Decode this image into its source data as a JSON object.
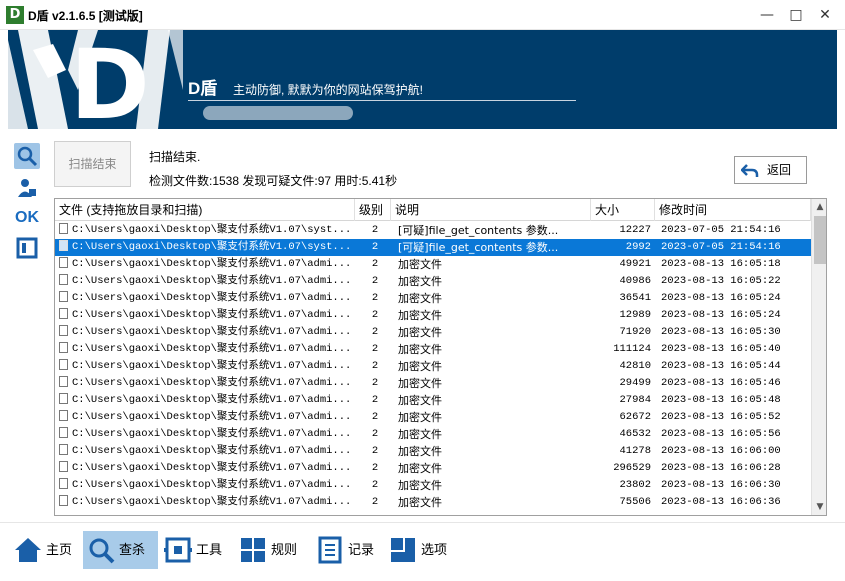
{
  "window": {
    "title": "D盾 v2.1.6.5 [测试版]",
    "minimize": "—",
    "maximize": "□",
    "close": "✕"
  },
  "banner": {
    "title": "D盾",
    "subtitle": "主动防御, 默默为你的网站保驾护航!",
    "logo_letter": "D"
  },
  "left_toolbar": {
    "items": [
      {
        "name": "search-icon",
        "active": true
      },
      {
        "name": "user-icon"
      },
      {
        "name": "ok-icon",
        "label": "OK"
      },
      {
        "name": "frame-icon"
      }
    ]
  },
  "scan": {
    "button_label": "扫描结束",
    "status": "扫描结束.",
    "stats": "检测文件数:1538 发现可疑文件:97 用时:5.41秒",
    "back_label": "返回"
  },
  "table": {
    "columns": [
      "文件 (支持拖放目录和扫描)",
      "级别",
      "说明",
      "大小",
      "修改时间"
    ],
    "rows": [
      {
        "file": "C:\\Users\\gaoxi\\Desktop\\聚支付系统V1.07\\syst...",
        "level": "2",
        "desc": "[可疑]file_get_contents 参数...",
        "size": "12227",
        "time": "2023-07-05 21:54:16",
        "selected": false
      },
      {
        "file": "C:\\Users\\gaoxi\\Desktop\\聚支付系统V1.07\\syst...",
        "level": "2",
        "desc": "[可疑]file_get_contents 参数...",
        "size": "2992",
        "time": "2023-07-05 21:54:16",
        "selected": true
      },
      {
        "file": "C:\\Users\\gaoxi\\Desktop\\聚支付系统V1.07\\admi...",
        "level": "2",
        "desc": "加密文件",
        "size": "49921",
        "time": "2023-08-13 16:05:18",
        "selected": false
      },
      {
        "file": "C:\\Users\\gaoxi\\Desktop\\聚支付系统V1.07\\admi...",
        "level": "2",
        "desc": "加密文件",
        "size": "40986",
        "time": "2023-08-13 16:05:22",
        "selected": false
      },
      {
        "file": "C:\\Users\\gaoxi\\Desktop\\聚支付系统V1.07\\admi...",
        "level": "2",
        "desc": "加密文件",
        "size": "36541",
        "time": "2023-08-13 16:05:24",
        "selected": false
      },
      {
        "file": "C:\\Users\\gaoxi\\Desktop\\聚支付系统V1.07\\admi...",
        "level": "2",
        "desc": "加密文件",
        "size": "12989",
        "time": "2023-08-13 16:05:24",
        "selected": false
      },
      {
        "file": "C:\\Users\\gaoxi\\Desktop\\聚支付系统V1.07\\admi...",
        "level": "2",
        "desc": "加密文件",
        "size": "71920",
        "time": "2023-08-13 16:05:30",
        "selected": false
      },
      {
        "file": "C:\\Users\\gaoxi\\Desktop\\聚支付系统V1.07\\admi...",
        "level": "2",
        "desc": "加密文件",
        "size": "111124",
        "time": "2023-08-13 16:05:40",
        "selected": false
      },
      {
        "file": "C:\\Users\\gaoxi\\Desktop\\聚支付系统V1.07\\admi...",
        "level": "2",
        "desc": "加密文件",
        "size": "42810",
        "time": "2023-08-13 16:05:44",
        "selected": false
      },
      {
        "file": "C:\\Users\\gaoxi\\Desktop\\聚支付系统V1.07\\admi...",
        "level": "2",
        "desc": "加密文件",
        "size": "29499",
        "time": "2023-08-13 16:05:46",
        "selected": false
      },
      {
        "file": "C:\\Users\\gaoxi\\Desktop\\聚支付系统V1.07\\admi...",
        "level": "2",
        "desc": "加密文件",
        "size": "27984",
        "time": "2023-08-13 16:05:48",
        "selected": false
      },
      {
        "file": "C:\\Users\\gaoxi\\Desktop\\聚支付系统V1.07\\admi...",
        "level": "2",
        "desc": "加密文件",
        "size": "62672",
        "time": "2023-08-13 16:05:52",
        "selected": false
      },
      {
        "file": "C:\\Users\\gaoxi\\Desktop\\聚支付系统V1.07\\admi...",
        "level": "2",
        "desc": "加密文件",
        "size": "46532",
        "time": "2023-08-13 16:05:56",
        "selected": false
      },
      {
        "file": "C:\\Users\\gaoxi\\Desktop\\聚支付系统V1.07\\admi...",
        "level": "2",
        "desc": "加密文件",
        "size": "41278",
        "time": "2023-08-13 16:06:00",
        "selected": false
      },
      {
        "file": "C:\\Users\\gaoxi\\Desktop\\聚支付系统V1.07\\admi...",
        "level": "2",
        "desc": "加密文件",
        "size": "296529",
        "time": "2023-08-13 16:06:28",
        "selected": false
      },
      {
        "file": "C:\\Users\\gaoxi\\Desktop\\聚支付系统V1.07\\admi...",
        "level": "2",
        "desc": "加密文件",
        "size": "23802",
        "time": "2023-08-13 16:06:30",
        "selected": false
      },
      {
        "file": "C:\\Users\\gaoxi\\Desktop\\聚支付系统V1.07\\admi...",
        "level": "2",
        "desc": "加密文件",
        "size": "75506",
        "time": "2023-08-13 16:06:36",
        "selected": false
      }
    ]
  },
  "bottom_nav": {
    "items": [
      {
        "label": "主页",
        "icon": "home-icon",
        "active": false
      },
      {
        "label": "查杀",
        "icon": "search-icon",
        "active": true
      },
      {
        "label": "工具",
        "icon": "tools-icon",
        "active": false
      },
      {
        "label": "规则",
        "icon": "rules-icon",
        "active": false
      },
      {
        "label": "记录",
        "icon": "log-icon",
        "active": false
      },
      {
        "label": "选项",
        "icon": "options-icon",
        "active": false
      }
    ]
  },
  "colors": {
    "banner_bg": "#003d6b",
    "selection": "#0a78d7",
    "nav_active": "#a8cbe9",
    "accent_blue": "#1a6cc0"
  }
}
